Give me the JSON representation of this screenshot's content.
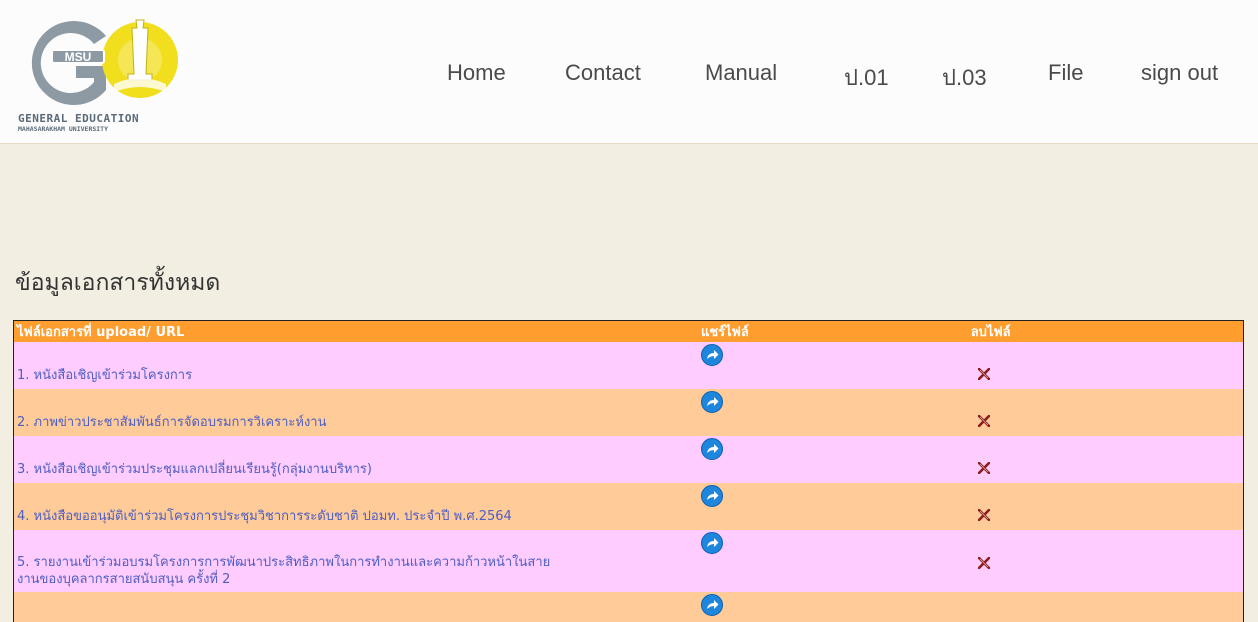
{
  "logo": {
    "text": "GENERAL EDUCATION",
    "subtext": "MAHASARAKHAM UNIVERSITY",
    "badge": "MSU"
  },
  "nav": [
    "Home",
    "Contact",
    "Manual",
    "ป.01",
    "ป.03",
    "File",
    "sign out"
  ],
  "page_title": "ข้อมูลเอกสารทั้งหมด",
  "table": {
    "headers": [
      "ไฟล์เอกสารที่ upload/ URL",
      "แชร์ไฟล์",
      "ลบไฟล์"
    ],
    "rows": [
      {
        "name": "1. หนังสือเชิญเข้าร่วมโครงการ"
      },
      {
        "name": "2. ภาพข่าวประชาสัมพันธ์การจัดอบรมการวิเคราะห์งาน"
      },
      {
        "name": "3. หนังสือเชิญเข้าร่วมประชุมแลกเปลี่ยนเรียนรู้(กลุ่มงานบริหาร)"
      },
      {
        "name": "4. หนังสือขออนุมัติเข้าร่วมโครงการประชุมวิชาการระดับชาติ ปอมท. ประจำปี พ.ศ.2564"
      },
      {
        "name_line1": "5. รายงานเข้าร่วมอบรมโครงการการพัฒนาประสิทธิภาพในการทำงานและความก้าวหน้าในสาย",
        "name_line2": "งานของบุคลากรสายสนับสนุน ครั้งที่ 2"
      }
    ]
  },
  "icons": {
    "share": "share-arrow-icon",
    "delete": "delete-x-icon"
  },
  "colors": {
    "header_row": "#ff9d2f",
    "row_pink": "#ffccff",
    "row_peach": "#ffcc99",
    "link": "#4e5ec3",
    "background": "#f2eee2"
  }
}
